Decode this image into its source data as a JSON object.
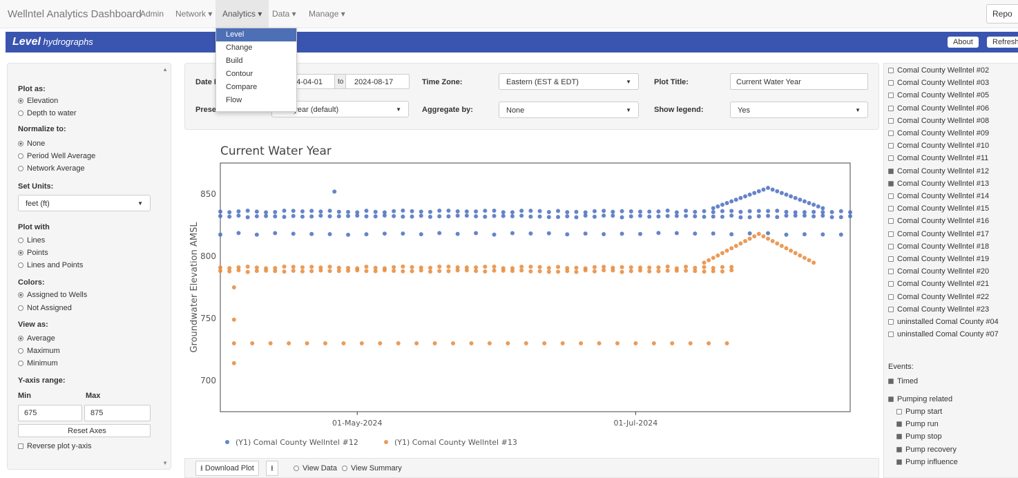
{
  "nav": {
    "brand": "Wellntel Analytics Dashboard",
    "items": [
      "Admin",
      "Network ▾",
      "Analytics ▾",
      "Data ▾",
      "Manage ▾"
    ],
    "report": "Repo"
  },
  "menu": [
    "Level",
    "Change",
    "Build",
    "Contour",
    "Compare",
    "Flow"
  ],
  "header": {
    "title_bold": "Level",
    "title_rest": " hydrographs",
    "about": "About",
    "refresh": "Refresh"
  },
  "form": {
    "date_label": "Date R",
    "date_from": "24-04-01",
    "to": "to",
    "date_to": "2024-08-17",
    "preset_label": "Preset",
    "preset_value": "one year (default)",
    "tz_label": "Time Zone:",
    "tz_value": "Eastern (EST & EDT)",
    "agg_label": "Aggregate by:",
    "agg_value": "None",
    "plot_title_label": "Plot Title:",
    "plot_title_value": "Current Water Year",
    "legend_label": "Show legend:",
    "legend_value": "Yes"
  },
  "sidebar": {
    "plot_as": "Plot as:",
    "elevation": "Elevation",
    "depth": "Depth to water",
    "normalize": "Normalize to:",
    "none": "None",
    "period": "Period Well Average",
    "network": "Network Average",
    "units": "Set Units:",
    "units_value": "feet (ft)",
    "plot_with": "Plot with",
    "lines": "Lines",
    "points": "Points",
    "lines_points": "Lines and Points",
    "colors": "Colors:",
    "assigned": "Assigned to Wells",
    "not_assigned": "Not Assigned",
    "view_as": "View as:",
    "average": "Average",
    "maximum": "Maximum",
    "minimum": "Minimum",
    "yrange": "Y-axis range:",
    "min": "Min",
    "max": "Max",
    "min_value": "675",
    "max_value": "875",
    "reset": "Reset Axes",
    "reverse": "Reverse plot y-axis"
  },
  "wells": [
    {
      "name": "Comal County Wellntel #02",
      "checked": false
    },
    {
      "name": "Comal County Wellntel #03",
      "checked": false
    },
    {
      "name": "Comal County Wellntel #05",
      "checked": false
    },
    {
      "name": "Comal County Wellntel #06",
      "checked": false
    },
    {
      "name": "Comal County Wellntel #08",
      "checked": false
    },
    {
      "name": "Comal County Wellntel #09",
      "checked": false
    },
    {
      "name": "Comal County Wellntel #10",
      "checked": false
    },
    {
      "name": "Comal County Wellntel #11",
      "checked": false
    },
    {
      "name": "Comal County Wellntel #12",
      "checked": true
    },
    {
      "name": "Comal County Wellntel #13",
      "checked": true
    },
    {
      "name": "Comal County Wellntel #14",
      "checked": false
    },
    {
      "name": "Comal County Wellntel #15",
      "checked": false
    },
    {
      "name": "Comal County Wellntel #16",
      "checked": false
    },
    {
      "name": "Comal County Wellntel #17",
      "checked": false
    },
    {
      "name": "Comal County Wellntel #18",
      "checked": false
    },
    {
      "name": "Comal County Wellntel #19",
      "checked": false
    },
    {
      "name": "Comal County Wellntel #20",
      "checked": false
    },
    {
      "name": "Comal County Wellntel #21",
      "checked": false
    },
    {
      "name": "Comal County Wellntel #22",
      "checked": false
    },
    {
      "name": "Comal County Wellntel #23",
      "checked": false
    },
    {
      "name": "uninstalled Comal County #04",
      "checked": false
    },
    {
      "name": "uninstalled Comal County #07",
      "checked": false
    }
  ],
  "events": {
    "label": "Events:",
    "timed": "Timed",
    "pumping": "Pumping related",
    "items": [
      "Pump start",
      "Pump run",
      "Pump stop",
      "Pump recovery",
      "Pump influence"
    ],
    "item_checked": [
      false,
      true,
      true,
      true,
      true
    ]
  },
  "bottom": {
    "download": "Download Plot",
    "view_data": "View Data",
    "view_summary": "View Summary"
  },
  "chart_data": {
    "type": "scatter",
    "title": "Current Water Year",
    "ylabel": "Groundwater Elevation AMSL",
    "xlabel": "",
    "x_range": [
      "2024-04-01",
      "2024-08-17"
    ],
    "ylim": [
      675,
      875
    ],
    "yticks": [
      700,
      750,
      800,
      850
    ],
    "xticks": [
      "01-May-2024",
      "01-Jul-2024"
    ],
    "legend_position": "bottom",
    "series": [
      {
        "name": "(Y1) Comal County Wellntel #12",
        "color": "#4a6fbf",
        "bands": [
          {
            "from": "2024-04-01",
            "to": "2024-08-17",
            "values": [
              836,
              832,
              818
            ]
          }
        ],
        "peak": {
          "date": "2024-07-30",
          "value": 855
        },
        "outliers": [
          {
            "date": "2024-04-26",
            "value": 852
          }
        ]
      },
      {
        "name": "(Y1) Comal County Wellntel #13",
        "color": "#e8893a",
        "bands": [
          {
            "from": "2024-04-01",
            "to": "2024-07-23",
            "values": [
              791,
              788
            ]
          }
        ],
        "peak": {
          "date": "2024-07-28",
          "value": 818
        },
        "low_band": 730,
        "outliers": [
          {
            "date": "2024-04-04",
            "value": 714
          },
          {
            "date": "2024-04-04",
            "value": 749
          },
          {
            "date": "2024-04-04",
            "value": 775
          }
        ]
      }
    ]
  }
}
